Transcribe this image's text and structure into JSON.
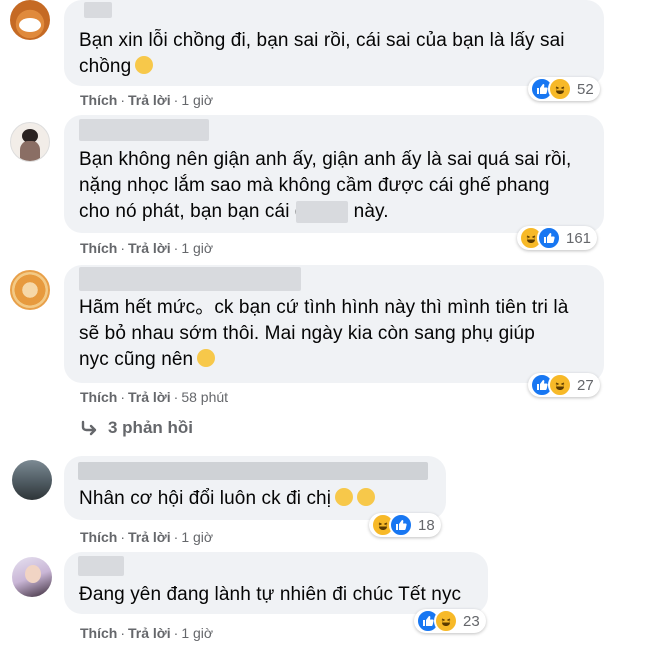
{
  "comments": [
    {
      "text": "Bạn xin lỗi chồng đi, bạn sai rồi, cái sai của bạn là lấy sai\nchồng",
      "emoji": "smile-emoji",
      "like_label": "Thích",
      "reply_label": "Trả lời",
      "time": "1 giờ",
      "reactions": [
        "like",
        "haha"
      ],
      "reaction_count": "52"
    },
    {
      "text": "Bạn không nên giận anh ấy, giận anh ấy là sai quá sai rồi,\nnặng nhọc lắm sao mà không cầm được cái ghế phang\ncho nó phát, bạn bạn cái      gì tầm này.",
      "like_label": "Thích",
      "reply_label": "Trả lời",
      "time": "1 giờ",
      "reactions": [
        "haha",
        "like"
      ],
      "reaction_count": "161"
    },
    {
      "text": "Hãm hết mức。ck bạn cứ tình hình này thì mình tiên tri là\nsẽ bỏ nhau sớm thôi. Mai ngày kia còn sang phụ giúp\nnyc cũng nên",
      "emoji": "relieved-emoji",
      "like_label": "Thích",
      "reply_label": "Trả lời",
      "time": "58 phút",
      "reactions": [
        "like",
        "haha"
      ],
      "reaction_count": "27"
    },
    {
      "text": "Nhân cơ hội đổi luôn ck đi chị",
      "emoji": "relieved-emoji",
      "like_label": "Thích",
      "reply_label": "Trả lời",
      "time": "1 giờ",
      "reactions": [
        "haha",
        "like"
      ],
      "reaction_count": "18"
    },
    {
      "text": "Đang yên đang lành tự nhiên đi chúc Tết nyc",
      "like_label": "Thích",
      "reply_label": "Trả lời",
      "time": "1 giờ",
      "reactions": [
        "like",
        "haha"
      ],
      "reaction_count": "23"
    }
  ],
  "replies_link": "3 phản hồi",
  "colors": {
    "like": "#1877f2",
    "haha": "#f7b928",
    "bubble": "#f0f2f5",
    "meta": "#65676b"
  }
}
